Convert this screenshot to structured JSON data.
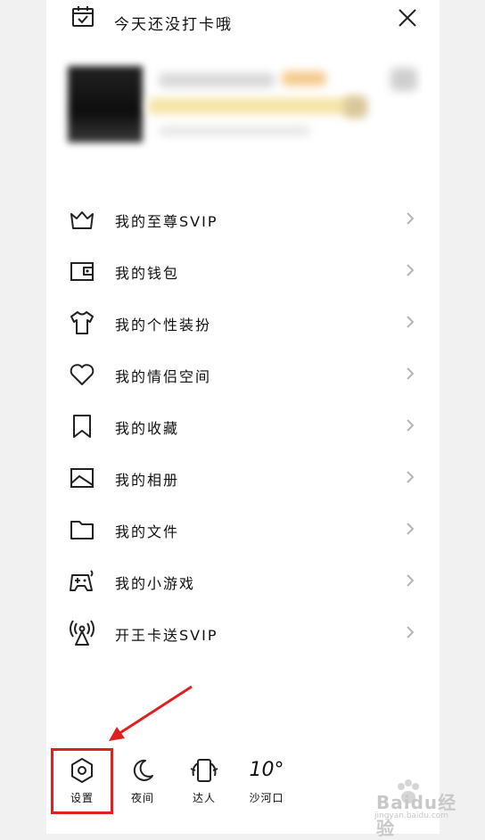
{
  "header": {
    "title": "今天还没打卡哦"
  },
  "menu": {
    "items": [
      {
        "label": "我的至尊SVIP",
        "icon": "crown-icon"
      },
      {
        "label": "我的钱包",
        "icon": "wallet-icon"
      },
      {
        "label": "我的个性装扮",
        "icon": "shirt-icon"
      },
      {
        "label": "我的情侣空间",
        "icon": "heart-icon"
      },
      {
        "label": "我的收藏",
        "icon": "bookmark-icon"
      },
      {
        "label": "我的相册",
        "icon": "photo-icon"
      },
      {
        "label": "我的文件",
        "icon": "folder-icon"
      },
      {
        "label": "我的小游戏",
        "icon": "gamepad-icon"
      },
      {
        "label": "开王卡送SVIP",
        "icon": "signal-tower-icon"
      }
    ]
  },
  "bottom_bar": {
    "settings_label": "设置",
    "night_label": "夜间",
    "expert_label": "达人",
    "weather_temp": "10°",
    "weather_place": "沙河口"
  },
  "watermark": {
    "main": "Baidu经验",
    "sub": "jingyan.baidu.com"
  },
  "colors": {
    "annotation_red": "#e02020",
    "icon_stroke": "#222222",
    "chevron": "#b5b5b5"
  }
}
